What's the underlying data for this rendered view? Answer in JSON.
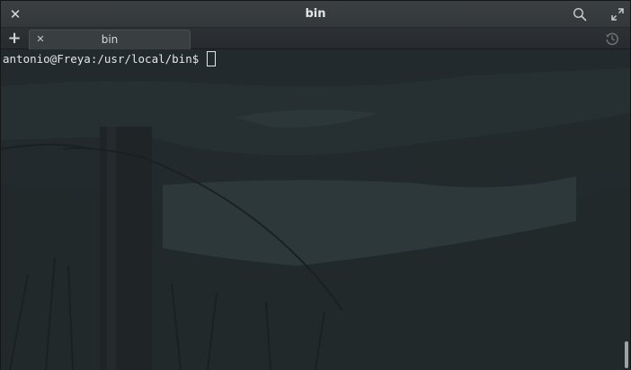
{
  "window": {
    "title": "bin"
  },
  "titlebar": {
    "close_icon": "close-icon",
    "search_icon": "search-icon",
    "maximize_icon": "maximize-icon"
  },
  "tabs": {
    "add_icon": "plus-icon",
    "items": [
      {
        "label": "bin",
        "close_icon": "close-icon",
        "active": true
      }
    ],
    "history_icon": "history-icon"
  },
  "terminal": {
    "prompt": "antonio@Freya:/usr/local/bin$ ",
    "text_color": "#e4e6e7",
    "background_color": "#232a2d"
  }
}
